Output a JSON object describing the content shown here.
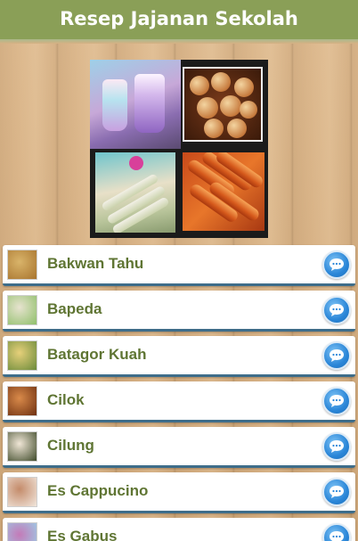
{
  "app": {
    "title": "Resep Jajanan Sekolah"
  },
  "colors": {
    "header_bg": "#8a9f57",
    "item_text": "#5f7533",
    "item_border": "#3e6d8a",
    "chat_button": "#2a86d8"
  },
  "recipes": [
    {
      "label": "Bakwan Tahu",
      "icon": "bakwan-tahu-thumbnail",
      "thumb_colors": [
        "#d9b46a",
        "#a8742e"
      ]
    },
    {
      "label": "Bapeda",
      "icon": "bapeda-thumbnail",
      "thumb_colors": [
        "#e7e3cf",
        "#8fbf6a"
      ]
    },
    {
      "label": "Batagor Kuah",
      "icon": "batagor-kuah-thumbnail",
      "thumb_colors": [
        "#e6d07a",
        "#6a8a3a"
      ]
    },
    {
      "label": "Cilok",
      "icon": "cilok-thumbnail",
      "thumb_colors": [
        "#d98a4a",
        "#6e3010"
      ]
    },
    {
      "label": "Cilung",
      "icon": "cilung-thumbnail",
      "thumb_colors": [
        "#f0e6d6",
        "#3e4a2a"
      ]
    },
    {
      "label": "Es Cappucino",
      "icon": "es-cappucino-thumbnail",
      "thumb_colors": [
        "#c48b6a",
        "#f1e6dc"
      ]
    },
    {
      "label": "Es Gabus",
      "icon": "es-gabus-thumbnail",
      "thumb_colors": [
        "#c47ab8",
        "#9ad0e8"
      ]
    }
  ]
}
